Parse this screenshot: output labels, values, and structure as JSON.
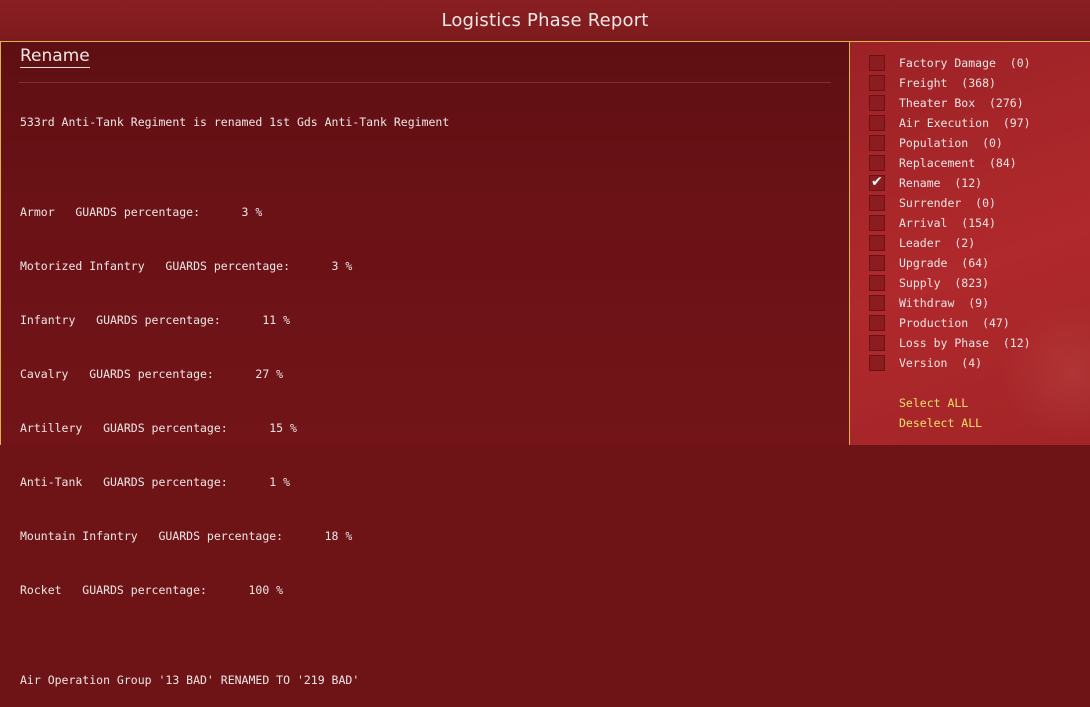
{
  "window": {
    "title": "Logistics Phase Report"
  },
  "section": {
    "title": "Rename"
  },
  "report_lines": [
    "533rd Anti-Tank Regiment is renamed 1st Gds Anti-Tank Regiment",
    "",
    "Armor   GUARDS percentage:      3 %",
    "Motorized Infantry   GUARDS percentage:      3 %",
    "Infantry   GUARDS percentage:      11 %",
    "Cavalry   GUARDS percentage:      27 %",
    "Artillery   GUARDS percentage:      15 %",
    "Anti-Tank   GUARDS percentage:      1 %",
    "Mountain Infantry   GUARDS percentage:      18 %",
    "Rocket   GUARDS percentage:      100 %",
    "",
    "Air Operation Group '13 BAD' RENAMED TO '219 BAD'"
  ],
  "filters": [
    {
      "label": "Factory Damage  (0)",
      "checked": false
    },
    {
      "label": "Freight  (368)",
      "checked": false
    },
    {
      "label": "Theater Box  (276)",
      "checked": false
    },
    {
      "label": "Air Execution  (97)",
      "checked": false
    },
    {
      "label": "Population  (0)",
      "checked": false
    },
    {
      "label": "Replacement  (84)",
      "checked": false
    },
    {
      "label": "Rename  (12)",
      "checked": true
    },
    {
      "label": "Surrender  (0)",
      "checked": false
    },
    {
      "label": "Arrival  (154)",
      "checked": false
    },
    {
      "label": "Leader  (2)",
      "checked": false
    },
    {
      "label": "Upgrade  (64)",
      "checked": false
    },
    {
      "label": "Supply  (823)",
      "checked": false
    },
    {
      "label": "Withdraw  (9)",
      "checked": false
    },
    {
      "label": "Production  (47)",
      "checked": false
    },
    {
      "label": "Loss by Phase  (12)",
      "checked": false
    },
    {
      "label": "Version  (4)",
      "checked": false
    }
  ],
  "actions": {
    "select_all": "Select ALL",
    "deselect_all": "Deselect ALL"
  },
  "colors": {
    "panel_bg": "#6e1416",
    "side_bg": "#b0292c",
    "border": "#d8b44a",
    "link": "#f4e06a"
  }
}
